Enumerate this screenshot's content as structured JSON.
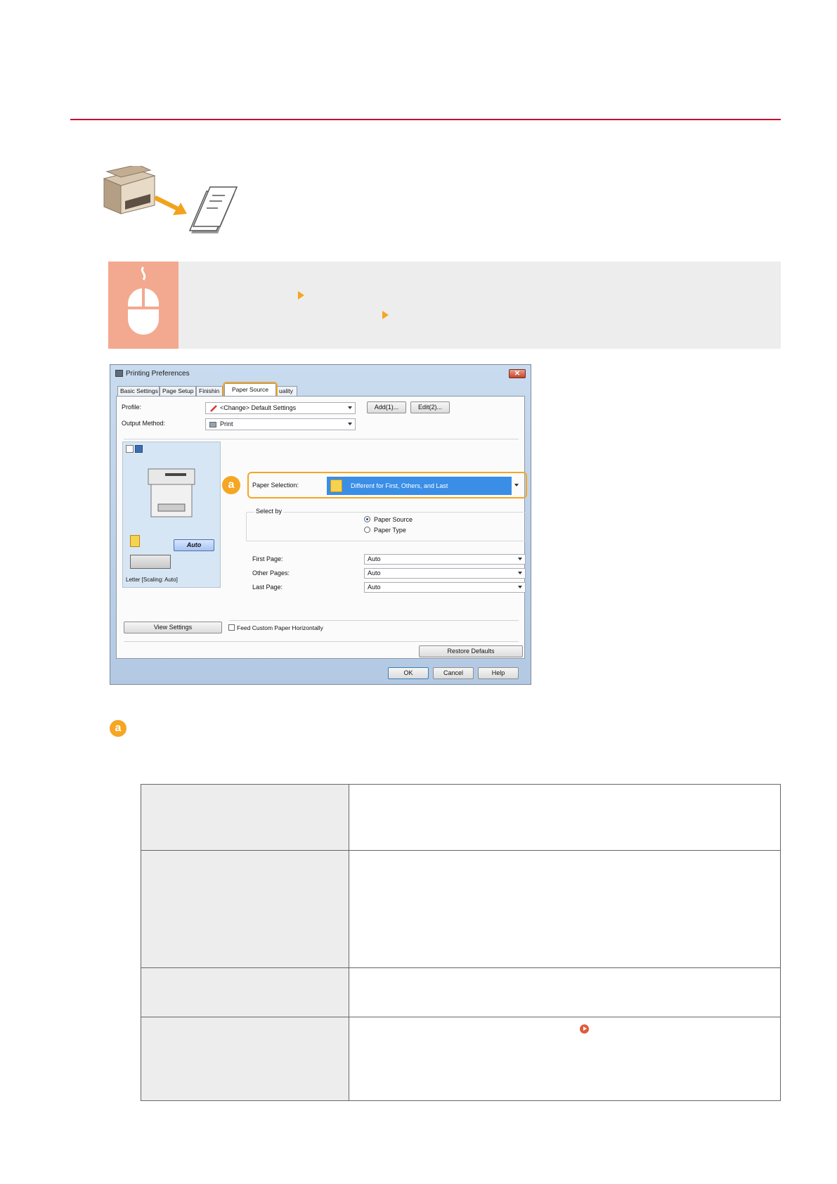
{
  "dialog": {
    "title": "Printing Preferences",
    "close_glyph": "✕",
    "tabs": [
      {
        "label": "Basic Settings"
      },
      {
        "label": "Page Setup"
      },
      {
        "label": "Finishin"
      },
      {
        "label": "Paper Source"
      },
      {
        "label": "uality"
      }
    ],
    "profile_label": "Profile:",
    "profile_value": "<Change> Default Settings",
    "add_button": "Add(1)...",
    "edit_button": "Edit(2)...",
    "output_method_label": "Output Method:",
    "output_method_value": "Print",
    "preview_auto_button": "Auto",
    "preview_caption": "Letter [Scaling: Auto]",
    "view_settings_button": "View Settings",
    "callout_marker": "a",
    "paper_selection_label": "Paper Selection:",
    "paper_selection_value": "Different for First, Others, and Last",
    "select_by_label": "Select by",
    "select_by_options": [
      {
        "label": "Paper Source",
        "selected": true
      },
      {
        "label": "Paper Type",
        "selected": false
      }
    ],
    "page_rows": [
      {
        "label": "First Page:",
        "value": "Auto"
      },
      {
        "label": "Other Pages:",
        "value": "Auto"
      },
      {
        "label": "Last Page:",
        "value": "Auto"
      }
    ],
    "feed_custom_label": "Feed Custom Paper Horizontally",
    "restore_defaults_button": "Restore Defaults",
    "ok_button": "OK",
    "cancel_button": "Cancel",
    "help_button": "Help"
  },
  "section_marker": "a",
  "colors": {
    "accent_rule": "#c8102e",
    "highlight": "#f5a623",
    "op_icon_bg": "#f3a98f",
    "selection_blue": "#3a8ee6"
  }
}
